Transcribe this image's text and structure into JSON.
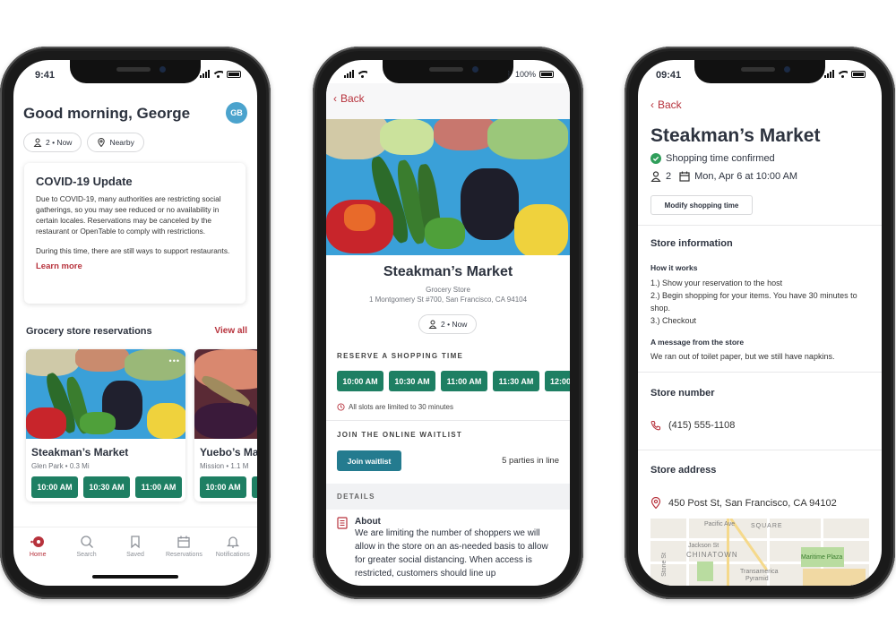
{
  "phone1": {
    "status": {
      "time": "9:41"
    },
    "greeting": "Good morning, George",
    "avatar_initials": "GB",
    "chips": [
      {
        "icon": "person-icon",
        "label": "2 • Now"
      },
      {
        "icon": "location-pin-icon",
        "label": "Nearby"
      }
    ],
    "covid": {
      "title": "COVID-19 Update",
      "paragraph1": "Due to COVID-19, many authorities are restricting social gatherings, so you may see reduced or no availability in certain locales. Reservations may be canceled by the restaurant or OpenTable to comply with restrictions.",
      "paragraph2": "During this time, there are still ways to support restaurants.",
      "link": "Learn more"
    },
    "section": {
      "title": "Grocery store reservations",
      "view_all": "View all"
    },
    "stores": [
      {
        "name": "Steakman’s Market",
        "sub": "Glen Park • 0.3 Mi",
        "slots": [
          "10:00 AM",
          "10:30 AM",
          "11:00 AM"
        ],
        "more": "•••"
      },
      {
        "name": "Yuebo’s Ma",
        "sub": "Mission • 1.1 M",
        "slots": [
          "10:00 AM"
        ]
      }
    ],
    "tabs": [
      {
        "label": "Home",
        "icon": "home-icon",
        "active": true
      },
      {
        "label": "Search",
        "icon": "search-icon"
      },
      {
        "label": "Saved",
        "icon": "bookmark-icon"
      },
      {
        "label": "Reservations",
        "icon": "calendar-icon"
      },
      {
        "label": "Notifications",
        "icon": "bell-icon"
      }
    ]
  },
  "phone2": {
    "status": {
      "battery": "100%"
    },
    "back": "Back",
    "title": "Steakman’s Market",
    "category": "Grocery Store",
    "address": "1 Montgomery St #700, San Francisco, CA 94104",
    "party_chip": "2 • Now",
    "reserve_label": "RESERVE A SHOPPING TIME",
    "slots": [
      "10:00 AM",
      "10:30 AM",
      "11:00 AM",
      "11:30 AM",
      "12:00"
    ],
    "limit_note": "All slots are limited to 30 minutes",
    "waitlist_label": "JOIN THE ONLINE WAITLIST",
    "waitlist_button": "Join waitlist",
    "parties": "5 parties in line",
    "details_label": "DETAILS",
    "about_title": "About",
    "about_text": "We are limiting the number of shoppers we will allow in the store on an as-needed basis to allow for greater social distancing. When access is restricted, customers should line up"
  },
  "phone3": {
    "status": {
      "time": "09:41"
    },
    "back": "Back",
    "title": "Steakman’s Market",
    "confirmed": "Shopping time confirmed",
    "party": "2",
    "datetime": "Mon, Apr 6 at 10:00 AM",
    "modify": "Modify shopping time",
    "store_info": "Store information",
    "how_it_works": "How it works",
    "steps": [
      "1.) Show your reservation to the host",
      "2.) Begin shopping for your items. You have 30 minutes to shop.",
      "3.) Checkout"
    ],
    "message_title": "A message from the store",
    "message": "We ran out of toilet paper, but we still have napkins.",
    "store_number_title": "Store number",
    "phone": "(415) 555-1108",
    "store_address_title": "Store address",
    "address": "450 Post St, San Francisco, CA 94102",
    "map_labels": [
      "Pacific Ave",
      "SQUARE",
      "Jackson St",
      "CHINATOWN",
      "Stone St",
      "Maritime Plaza",
      "Transamerica",
      "Pyramid"
    ]
  },
  "colors": {
    "accent_red": "#b7323c",
    "slot_green": "#1e7f63",
    "waitlist_teal": "#247b8f",
    "avatar_blue": "#4ba3cd",
    "confirm_green": "#2f9e5a"
  }
}
